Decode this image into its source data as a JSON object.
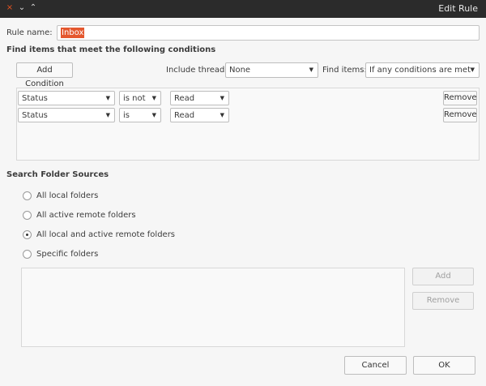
{
  "window": {
    "title": "Edit Rule",
    "controls": {
      "close": "×",
      "minimize": "⌄",
      "maximize": "⌃"
    }
  },
  "rule_name": {
    "label": "Rule name:",
    "value": "Inbox"
  },
  "conditions_heading": "Find items that meet the following conditions",
  "toolbar": {
    "add_condition": "Add Condition",
    "include_threads_label": "Include threads",
    "include_threads_value": "None",
    "find_items_label": "Find items:",
    "find_items_value": "If any conditions are met"
  },
  "conditions": [
    {
      "field": "Status",
      "operator": "is not",
      "value": "Read",
      "remove": "Remove"
    },
    {
      "field": "Status",
      "operator": "is",
      "value": "Read",
      "remove": "Remove"
    }
  ],
  "sources": {
    "heading": "Search Folder Sources",
    "options": [
      {
        "label": "All local folders",
        "checked": false
      },
      {
        "label": "All active remote folders",
        "checked": false
      },
      {
        "label": "All local and active remote folders",
        "checked": true
      },
      {
        "label": "Specific folders",
        "checked": false
      }
    ],
    "add_label": "Add",
    "remove_label": "Remove"
  },
  "footer": {
    "cancel_label": "Cancel",
    "ok_label": "OK"
  }
}
